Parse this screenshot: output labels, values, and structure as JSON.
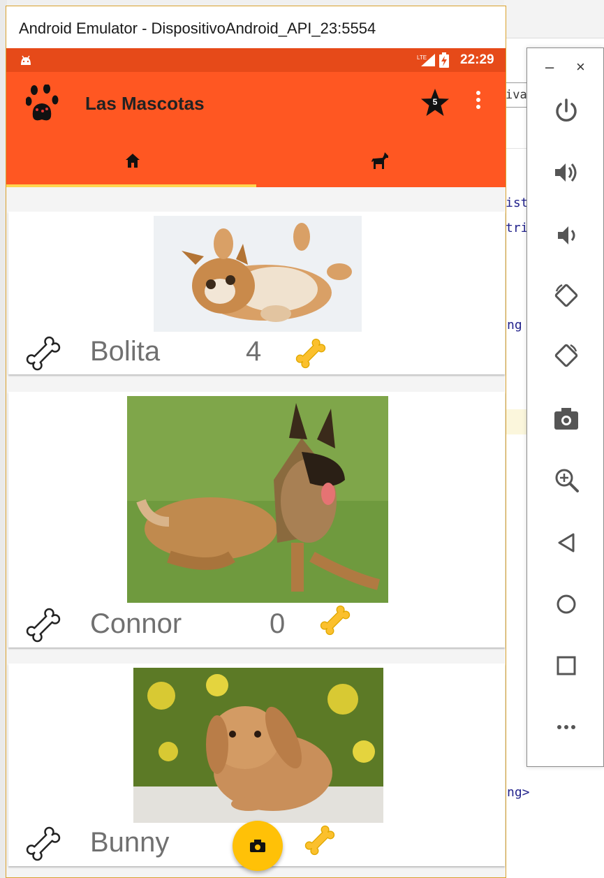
{
  "window": {
    "title": "Android Emulator - DispositivoAndroid_API_23:5554"
  },
  "status_bar": {
    "time": "22:29",
    "network_label": "LTE"
  },
  "app_bar": {
    "title": "Las Mascotas",
    "favorites_count": "5"
  },
  "tabs": [
    {
      "name": "home"
    },
    {
      "name": "dog"
    }
  ],
  "pets": [
    {
      "name": "Bolita",
      "likes": "4",
      "photo": "kitten"
    },
    {
      "name": "Connor",
      "likes": "0",
      "photo": "shepherd-dog"
    },
    {
      "name": "Bunny",
      "likes": "",
      "photo": "rabbit"
    }
  ],
  "ide_background": {
    "tab_fragment": "iva",
    "code_fragments": [
      "ist",
      "tri",
      "ng",
      "ng>"
    ]
  },
  "toolbar": {
    "minimize": "–",
    "close": "×",
    "tools": [
      "power-icon",
      "volume-up-icon",
      "volume-down-icon",
      "rotate-left-icon",
      "rotate-right-icon",
      "camera-icon",
      "zoom-icon",
      "back-icon",
      "home-icon",
      "overview-icon",
      "more-icon"
    ]
  },
  "colors": {
    "status_bar": "#e64a19",
    "app_bar": "#ff5722",
    "tab_indicator": "#ffd54f",
    "fab": "#ffc107",
    "bone_yellow": "#fbc02d"
  }
}
